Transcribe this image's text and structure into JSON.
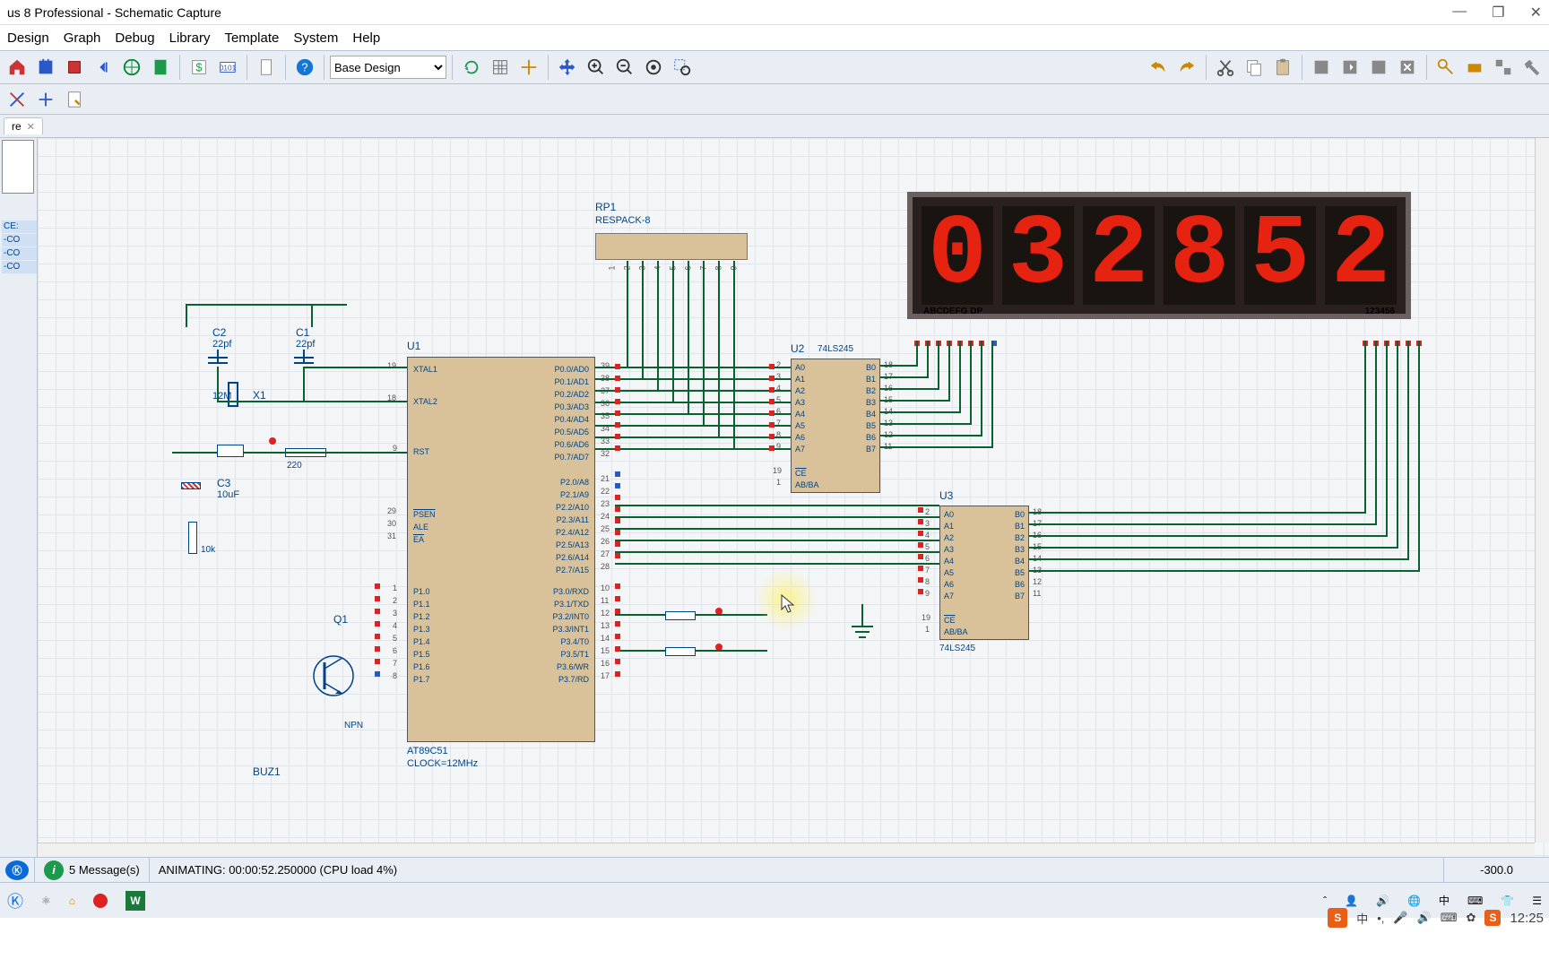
{
  "window": {
    "title": "us 8 Professional - Schematic Capture",
    "minimize": "—",
    "maximize": "❐",
    "close": "✕"
  },
  "menu": [
    "Design",
    "Graph",
    "Debug",
    "Library",
    "Template",
    "System",
    "Help"
  ],
  "toolbar": {
    "variant_label": "Base Design"
  },
  "tab": {
    "label": "re",
    "close": "✕"
  },
  "sidebar": {
    "devices": [
      "CE:",
      "-CO",
      "-CO",
      "-CO"
    ]
  },
  "schematic": {
    "rp1": {
      "ref": "RP1",
      "val": "RESPACK-8",
      "pins": [
        "1",
        "2",
        "3",
        "4",
        "5",
        "6",
        "7",
        "8",
        "9"
      ]
    },
    "u1": {
      "ref": "U1",
      "part": "AT89C51",
      "clock": "CLOCK=12MHz",
      "left_pins": [
        {
          "n": "19",
          "name": "XTAL1"
        },
        {
          "n": "18",
          "name": "XTAL2"
        },
        {
          "n": "9",
          "name": "RST"
        },
        {
          "n": "29",
          "name": "PSEN",
          "ov": true
        },
        {
          "n": "30",
          "name": "ALE"
        },
        {
          "n": "31",
          "name": "EA",
          "ov": true
        },
        {
          "n": "1",
          "name": "P1.0"
        },
        {
          "n": "2",
          "name": "P1.1"
        },
        {
          "n": "3",
          "name": "P1.2"
        },
        {
          "n": "4",
          "name": "P1.3"
        },
        {
          "n": "5",
          "name": "P1.4"
        },
        {
          "n": "6",
          "name": "P1.5"
        },
        {
          "n": "7",
          "name": "P1.6"
        },
        {
          "n": "8",
          "name": "P1.7"
        }
      ],
      "right_pins": [
        {
          "n": "39",
          "name": "P0.0/AD0"
        },
        {
          "n": "38",
          "name": "P0.1/AD1"
        },
        {
          "n": "37",
          "name": "P0.2/AD2"
        },
        {
          "n": "36",
          "name": "P0.3/AD3"
        },
        {
          "n": "35",
          "name": "P0.4/AD4"
        },
        {
          "n": "34",
          "name": "P0.5/AD5"
        },
        {
          "n": "33",
          "name": "P0.6/AD6"
        },
        {
          "n": "32",
          "name": "P0.7/AD7"
        },
        {
          "n": "21",
          "name": "P2.0/A8"
        },
        {
          "n": "22",
          "name": "P2.1/A9"
        },
        {
          "n": "23",
          "name": "P2.2/A10"
        },
        {
          "n": "24",
          "name": "P2.3/A11"
        },
        {
          "n": "25",
          "name": "P2.4/A12"
        },
        {
          "n": "26",
          "name": "P2.5/A13"
        },
        {
          "n": "27",
          "name": "P2.6/A14"
        },
        {
          "n": "28",
          "name": "P2.7/A15"
        },
        {
          "n": "10",
          "name": "P3.0/RXD"
        },
        {
          "n": "11",
          "name": "P3.1/TXD"
        },
        {
          "n": "12",
          "name": "P3.2/INT0",
          "ov": true
        },
        {
          "n": "13",
          "name": "P3.3/INT1",
          "ov": true
        },
        {
          "n": "14",
          "name": "P3.4/T0"
        },
        {
          "n": "15",
          "name": "P3.5/T1"
        },
        {
          "n": "16",
          "name": "P3.6/WR",
          "ov": true
        },
        {
          "n": "17",
          "name": "P3.7/RD",
          "ov": true
        }
      ]
    },
    "u2": {
      "ref": "U2",
      "part": "74LS245",
      "left": [
        {
          "n": "2",
          "name": "A0"
        },
        {
          "n": "3",
          "name": "A1"
        },
        {
          "n": "4",
          "name": "A2"
        },
        {
          "n": "5",
          "name": "A3"
        },
        {
          "n": "6",
          "name": "A4"
        },
        {
          "n": "7",
          "name": "A5"
        },
        {
          "n": "8",
          "name": "A6"
        },
        {
          "n": "9",
          "name": "A7"
        },
        {
          "n": "19",
          "name": "CE",
          "ov": true
        },
        {
          "n": "1",
          "name": "AB/BA",
          "ov2": true
        }
      ],
      "right": [
        {
          "n": "18",
          "name": "B0"
        },
        {
          "n": "17",
          "name": "B1"
        },
        {
          "n": "16",
          "name": "B2"
        },
        {
          "n": "15",
          "name": "B3"
        },
        {
          "n": "14",
          "name": "B4"
        },
        {
          "n": "13",
          "name": "B5"
        },
        {
          "n": "12",
          "name": "B6"
        },
        {
          "n": "11",
          "name": "B7"
        }
      ]
    },
    "u3": {
      "ref": "U3",
      "part": "74LS245",
      "left": [
        {
          "n": "2",
          "name": "A0"
        },
        {
          "n": "3",
          "name": "A1"
        },
        {
          "n": "4",
          "name": "A2"
        },
        {
          "n": "5",
          "name": "A3"
        },
        {
          "n": "6",
          "name": "A4"
        },
        {
          "n": "7",
          "name": "A5"
        },
        {
          "n": "8",
          "name": "A6"
        },
        {
          "n": "9",
          "name": "A7"
        },
        {
          "n": "19",
          "name": "CE",
          "ov": true
        },
        {
          "n": "1",
          "name": "AB/BA",
          "ov2": true
        }
      ],
      "right": [
        {
          "n": "18",
          "name": "B0"
        },
        {
          "n": "17",
          "name": "B1"
        },
        {
          "n": "16",
          "name": "B2"
        },
        {
          "n": "15",
          "name": "B3"
        },
        {
          "n": "14",
          "name": "B4"
        },
        {
          "n": "13",
          "name": "B5"
        },
        {
          "n": "12",
          "name": "B6"
        },
        {
          "n": "11",
          "name": "B7"
        }
      ]
    },
    "c1": {
      "ref": "C1",
      "val": "22pf"
    },
    "c2": {
      "ref": "C2",
      "val": "22pf"
    },
    "c3": {
      "ref": "C3",
      "val": "10uF"
    },
    "x1": {
      "ref": "X1",
      "val": "12M"
    },
    "r_220": "220",
    "r_10k": "10k",
    "q1": {
      "ref": "Q1",
      "val": "NPN"
    },
    "buz1": {
      "ref": "BUZ1"
    },
    "display": {
      "digits": [
        "0",
        "3",
        "2",
        "8",
        "5",
        "2"
      ],
      "seg": "ABCDEFG DP",
      "dig": "123456"
    }
  },
  "status": {
    "messages": "5 Message(s)",
    "anim": "ANIMATING: 00:00:52.250000 (CPU load 4%)",
    "coord": "-300.0"
  },
  "systray": {
    "time": "12:25"
  }
}
